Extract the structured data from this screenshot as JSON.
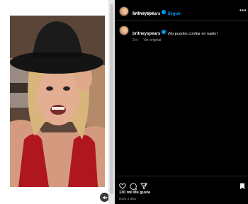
{
  "post": {
    "username": "britneyspears",
    "follow_label": "Seguir",
    "audio_label": "Audio original",
    "more_icon": "more-horizontal-icon"
  },
  "caption": {
    "username": "britneyspears",
    "text": "¡No puedes confiar en nadie!",
    "age": "2 d",
    "see_translation": "Ver original"
  },
  "actions": {
    "like_icon": "heart-icon",
    "comment_icon": "comment-icon",
    "share_icon": "send-icon",
    "save_icon": "bookmark-icon"
  },
  "stats": {
    "likes": "130 mil Me gusta",
    "posted": "Hace 2 días"
  },
  "colors": {
    "accent": "#0095f6",
    "background": "#000000"
  }
}
